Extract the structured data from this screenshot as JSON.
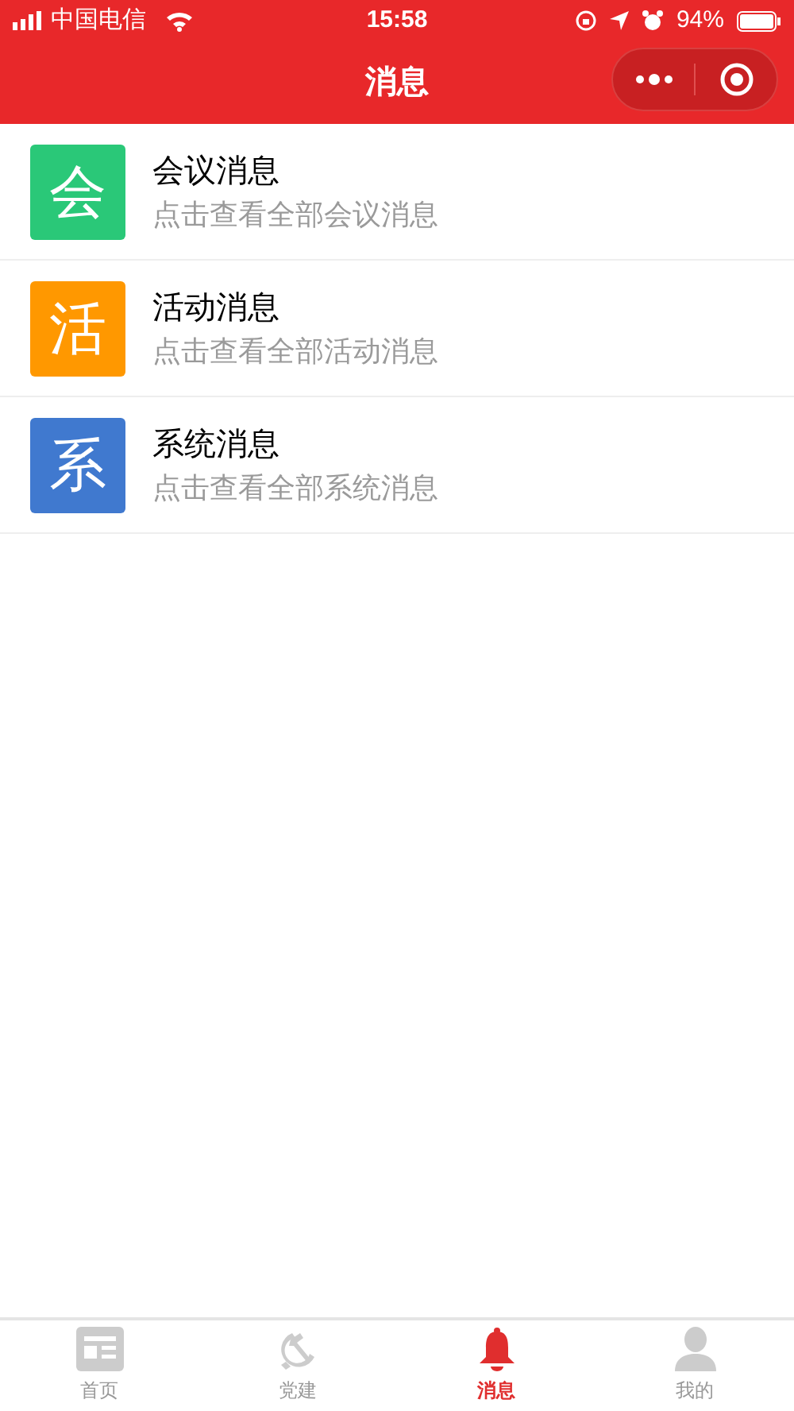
{
  "status_bar": {
    "carrier": "中国电信",
    "time": "15:58",
    "battery": "94%"
  },
  "header": {
    "title": "消息"
  },
  "messages": [
    {
      "badge": "会",
      "color": "#2ac878",
      "title": "会议消息",
      "subtitle": "点击查看全部会议消息"
    },
    {
      "badge": "活",
      "color": "#ff9800",
      "title": "活动消息",
      "subtitle": "点击查看全部活动消息"
    },
    {
      "badge": "系",
      "color": "#4079cf",
      "title": "系统消息",
      "subtitle": "点击查看全部系统消息"
    }
  ],
  "tab_bar": [
    {
      "kind": "home",
      "label": "首页",
      "selected": false
    },
    {
      "kind": "party",
      "label": "党建",
      "selected": false
    },
    {
      "kind": "bell",
      "label": "消息",
      "selected": true
    },
    {
      "kind": "person",
      "label": "我的",
      "selected": false
    }
  ]
}
